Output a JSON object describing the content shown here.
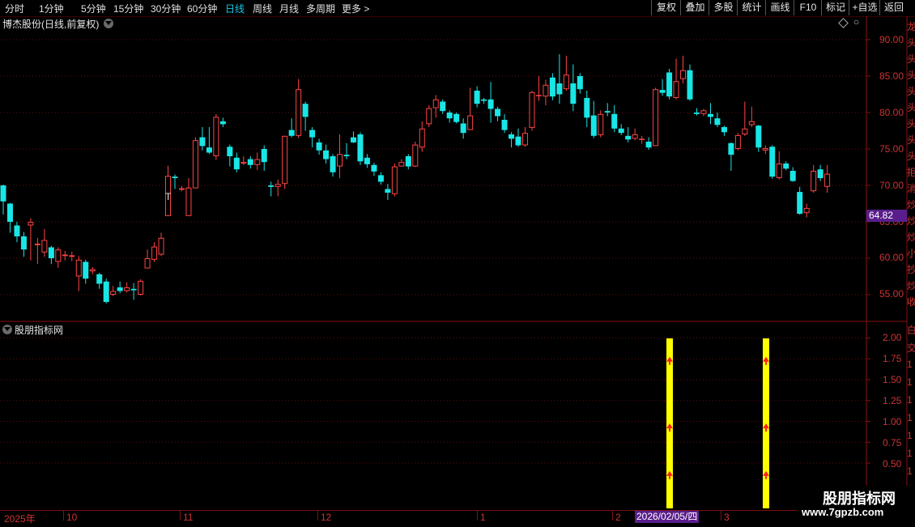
{
  "toolbar": {
    "periods": [
      "分时",
      "1分钟",
      "5分钟",
      "15分钟",
      "30分钟",
      "60分钟",
      "日线",
      "周线",
      "月线",
      "多周期",
      "更多"
    ],
    "active_period": "日线",
    "buttons": [
      "复权",
      "叠加",
      "多股",
      "统计",
      "画线",
      "F10",
      "标记",
      "+自选",
      "返回"
    ]
  },
  "main_panel": {
    "title": "博杰股份(日线,前复权)",
    "current_price_label": "64.82",
    "y_ticks": [
      "90.00",
      "85.00",
      "80.00",
      "75.00",
      "70.00",
      "65.00",
      "60.00",
      "55.00"
    ],
    "marker_text": "T"
  },
  "indicator_panel": {
    "title": "股朋指标网",
    "y_ticks": [
      "2.00",
      "1.75",
      "1.50",
      "1.25",
      "1.00",
      "0.75",
      "0.50"
    ]
  },
  "x_axis": {
    "labels": [
      "2025年",
      "10",
      "11",
      "12",
      "1",
      "2",
      "3"
    ],
    "highlight_date": "2026/02/05/四"
  },
  "right_column_chars": [
    "龙",
    "头",
    "头",
    "头",
    "头",
    "头",
    "头",
    "头",
    "头",
    "拒",
    "消",
    "炒",
    "炒",
    "炒",
    "小",
    "抄",
    "炒",
    "收"
  ],
  "right_column_chars_lower": [
    "白",
    "交",
    "1",
    "1",
    "1",
    "1",
    "1",
    "1",
    "1",
    "1"
  ],
  "watermark": {
    "title": "股朋指标网",
    "url": "www.7gpzb.com"
  },
  "colors": {
    "up": "#ff4444",
    "down": "#19e6e6",
    "grid": "#6a0b0b",
    "signal": "#ffff00",
    "accent": "#5a1e8c"
  },
  "chart_data": {
    "type": "candlestick",
    "ylim": [
      52,
      92
    ],
    "candles": [
      [
        70.0,
        67.8,
        70.1,
        66.0
      ],
      [
        67.5,
        65.0,
        67.6,
        63.5
      ],
      [
        64.5,
        63.0,
        65.0,
        62.2
      ],
      [
        63.0,
        61.2,
        63.6,
        60.2
      ],
      [
        64.5,
        65.0,
        65.5,
        59.7
      ],
      [
        61.8,
        62.0,
        62.8,
        59.2
      ],
      [
        60.8,
        62.5,
        64.0,
        60.2
      ],
      [
        61.5,
        60.0,
        61.7,
        59.2
      ],
      [
        59.5,
        61.2,
        61.5,
        58.7
      ],
      [
        60.3,
        60.5,
        61.0,
        59.7
      ],
      [
        60.2,
        60.4,
        60.9,
        59.6
      ],
      [
        57.5,
        59.8,
        60.3,
        55.5
      ],
      [
        59.5,
        57.2,
        59.8,
        56.5
      ],
      [
        58.2,
        58.5,
        58.8,
        57.8
      ],
      [
        57.8,
        56.5,
        58.0,
        55.8
      ],
      [
        56.8,
        54.0,
        57.2,
        53.8
      ],
      [
        55.0,
        55.5,
        56.2,
        54.8
      ],
      [
        56.0,
        55.5,
        56.8,
        55.2
      ],
      [
        55.5,
        56.0,
        56.7,
        55.3
      ],
      [
        55.8,
        55.6,
        56.6,
        54.3
      ],
      [
        55.0,
        56.9,
        57.1,
        54.9
      ],
      [
        58.6,
        60.0,
        61.2,
        58.6
      ],
      [
        59.8,
        61.6,
        62.2,
        59.5
      ],
      [
        60.5,
        62.8,
        63.5,
        60.3
      ],
      [
        65.8,
        71.3,
        72.7,
        65.8
      ],
      [
        71.2,
        71.0,
        71.5,
        69.5
      ],
      [
        69.4,
        69.6,
        69.9,
        69.2
      ],
      [
        65.8,
        69.7,
        71.0,
        65.8
      ],
      [
        69.6,
        76.2,
        76.6,
        69.6
      ],
      [
        76.6,
        75.4,
        78.0,
        74.8
      ],
      [
        75.2,
        74.5,
        78.0,
        74.3
      ],
      [
        74.0,
        79.4,
        79.8,
        73.5
      ],
      [
        78.8,
        78.4,
        79.3,
        78.0
      ],
      [
        75.3,
        74.0,
        75.6,
        72.6
      ],
      [
        73.8,
        72.2,
        74.5,
        71.8
      ],
      [
        73.0,
        73.2,
        74.0,
        72.8
      ],
      [
        73.6,
        72.8,
        74.0,
        72.3
      ],
      [
        72.8,
        73.6,
        74.5,
        72.1
      ],
      [
        75.0,
        73.2,
        75.5,
        72.0
      ],
      [
        70.0,
        69.8,
        70.5,
        68.5
      ],
      [
        69.8,
        70.2,
        70.8,
        68.5
      ],
      [
        70.2,
        76.8,
        76.8,
        69.5
      ],
      [
        77.6,
        76.8,
        79.2,
        76.6
      ],
      [
        76.8,
        83.2,
        84.6,
        76.5
      ],
      [
        81.2,
        79.4,
        81.5,
        77.5
      ],
      [
        77.6,
        76.6,
        78.0,
        75.2
      ],
      [
        75.9,
        74.8,
        76.4,
        74.2
      ],
      [
        74.8,
        73.6,
        75.6,
        73.0
      ],
      [
        74.0,
        71.8,
        74.3,
        71.2
      ],
      [
        72.6,
        74.3,
        77.0,
        71.0
      ],
      [
        74.2,
        74.0,
        75.8,
        73.6
      ],
      [
        76.6,
        75.9,
        77.4,
        75.8
      ],
      [
        77.0,
        73.3,
        77.3,
        72.8
      ],
      [
        73.8,
        72.9,
        74.3,
        72.4
      ],
      [
        72.8,
        71.9,
        73.1,
        71.3
      ],
      [
        71.4,
        70.5,
        71.8,
        70.1
      ],
      [
        69.5,
        69.0,
        70.2,
        68.0
      ],
      [
        68.8,
        72.6,
        73.0,
        68.5
      ],
      [
        72.6,
        73.2,
        73.6,
        72.6
      ],
      [
        74.0,
        72.6,
        74.3,
        72.2
      ],
      [
        72.6,
        75.6,
        76.0,
        72.5
      ],
      [
        75.2,
        77.8,
        78.8,
        74.6
      ],
      [
        78.4,
        80.6,
        81.0,
        78.0
      ],
      [
        80.6,
        81.8,
        82.4,
        79.3
      ],
      [
        81.5,
        80.2,
        81.8,
        79.8
      ],
      [
        80.0,
        79.2,
        80.3,
        78.6
      ],
      [
        79.8,
        78.7,
        80.0,
        78.5
      ],
      [
        78.5,
        77.2,
        79.2,
        76.4
      ],
      [
        77.6,
        79.6,
        83.4,
        77.6
      ],
      [
        83.0,
        81.2,
        83.6,
        80.7
      ],
      [
        81.8,
        81.6,
        82.0,
        81.2
      ],
      [
        81.8,
        80.5,
        84.2,
        78.6
      ],
      [
        80.5,
        79.5,
        80.8,
        78.8
      ],
      [
        79.0,
        77.6,
        79.8,
        77.2
      ],
      [
        77.0,
        76.4,
        77.3,
        75.2
      ],
      [
        76.7,
        75.5,
        77.8,
        75.3
      ],
      [
        75.5,
        77.2,
        78.0,
        75.3
      ],
      [
        77.9,
        82.8,
        83.0,
        77.5
      ],
      [
        82.4,
        82.4,
        85.0,
        81.6
      ],
      [
        82.2,
        83.8,
        84.5,
        81.0
      ],
      [
        84.8,
        82.2,
        85.4,
        81.7
      ],
      [
        84.0,
        82.5,
        88.0,
        81.2
      ],
      [
        83.2,
        85.2,
        87.8,
        83.0
      ],
      [
        84.0,
        81.2,
        86.6,
        80.2
      ],
      [
        85.0,
        83.2,
        85.4,
        82.6
      ],
      [
        82.0,
        79.3,
        83.0,
        78.0
      ],
      [
        79.6,
        76.8,
        81.6,
        76.5
      ],
      [
        76.9,
        79.8,
        80.3,
        76.6
      ],
      [
        80.2,
        80.0,
        81.3,
        79.5
      ],
      [
        79.8,
        77.8,
        81.0,
        77.3
      ],
      [
        77.8,
        77.2,
        78.4,
        76.9
      ],
      [
        76.8,
        76.3,
        78.0,
        75.9
      ],
      [
        76.4,
        77.0,
        77.8,
        76.2
      ],
      [
        76.4,
        76.4,
        76.8,
        75.7
      ],
      [
        76.0,
        75.2,
        76.6,
        74.9
      ],
      [
        75.4,
        83.2,
        83.4,
        75.4
      ],
      [
        83.1,
        82.7,
        84.6,
        82.3
      ],
      [
        85.5,
        82.2,
        86.0,
        81.8
      ],
      [
        82.0,
        84.3,
        87.4,
        81.8
      ],
      [
        84.6,
        85.8,
        87.8,
        84.0
      ],
      [
        85.8,
        81.8,
        86.6,
        81.6
      ],
      [
        80.0,
        79.8,
        80.6,
        79.6
      ],
      [
        79.8,
        80.3,
        80.5,
        79.5
      ],
      [
        79.8,
        79.4,
        81.3,
        78.4
      ],
      [
        79.2,
        78.3,
        80.0,
        78.0
      ],
      [
        78.0,
        77.3,
        78.2,
        76.8
      ],
      [
        75.8,
        74.2,
        75.9,
        72.0
      ],
      [
        75.0,
        76.9,
        77.2,
        74.8
      ],
      [
        77.0,
        77.8,
        81.5,
        76.8
      ],
      [
        78.3,
        78.8,
        80.8,
        78.0
      ],
      [
        78.2,
        75.2,
        78.3,
        74.6
      ],
      [
        74.8,
        75.1,
        75.5,
        74.3
      ],
      [
        75.3,
        71.2,
        75.5,
        70.9
      ],
      [
        71.0,
        73.0,
        74.7,
        70.8
      ],
      [
        73.0,
        72.3,
        73.3,
        72.1
      ],
      [
        72.0,
        70.6,
        72.5,
        70.5
      ],
      [
        69.1,
        66.1,
        69.8,
        66.0
      ],
      [
        66.2,
        66.9,
        67.5,
        65.6
      ],
      [
        69.2,
        72.0,
        72.8,
        69.0
      ],
      [
        72.2,
        71.0,
        72.8,
        70.6
      ],
      [
        69.8,
        71.6,
        72.8,
        69.0
      ]
    ],
    "signals": [
      {
        "date": "2026/02/05",
        "value": 2.0,
        "markers": [
          1.75,
          0.95,
          0.38
        ]
      },
      {
        "date": "2026/03",
        "value": 2.0,
        "markers": [
          1.75,
          0.95,
          0.38
        ]
      }
    ],
    "indicator_ylim": [
      0,
      2.2
    ]
  }
}
